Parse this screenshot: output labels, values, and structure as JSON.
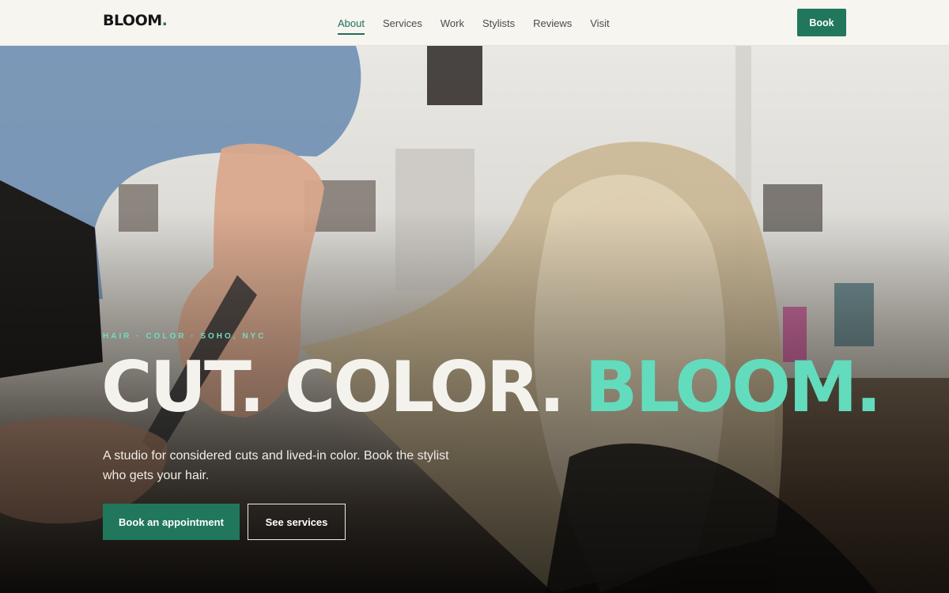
{
  "brand": {
    "name": "BLOOM",
    "dot": "."
  },
  "nav": {
    "items": [
      {
        "label": "About",
        "active": true
      },
      {
        "label": "Services",
        "active": false
      },
      {
        "label": "Work",
        "active": false
      },
      {
        "label": "Stylists",
        "active": false
      },
      {
        "label": "Reviews",
        "active": false
      },
      {
        "label": "Visit",
        "active": false
      }
    ],
    "book_label": "Book"
  },
  "hero": {
    "eyebrow": "HAIR · COLOR · SOHO, NYC",
    "headline_main": "CUT. COLOR. ",
    "headline_accent": "BLOOM.",
    "subtext": "A studio for considered cuts and lived-in color. Book the stylist who gets your hair.",
    "primary_button": "Book an appointment",
    "secondary_button": "See services"
  },
  "colors": {
    "brand_green": "#21775c",
    "accent_mint": "#62dcbd",
    "header_bg": "#f6f5f0"
  }
}
